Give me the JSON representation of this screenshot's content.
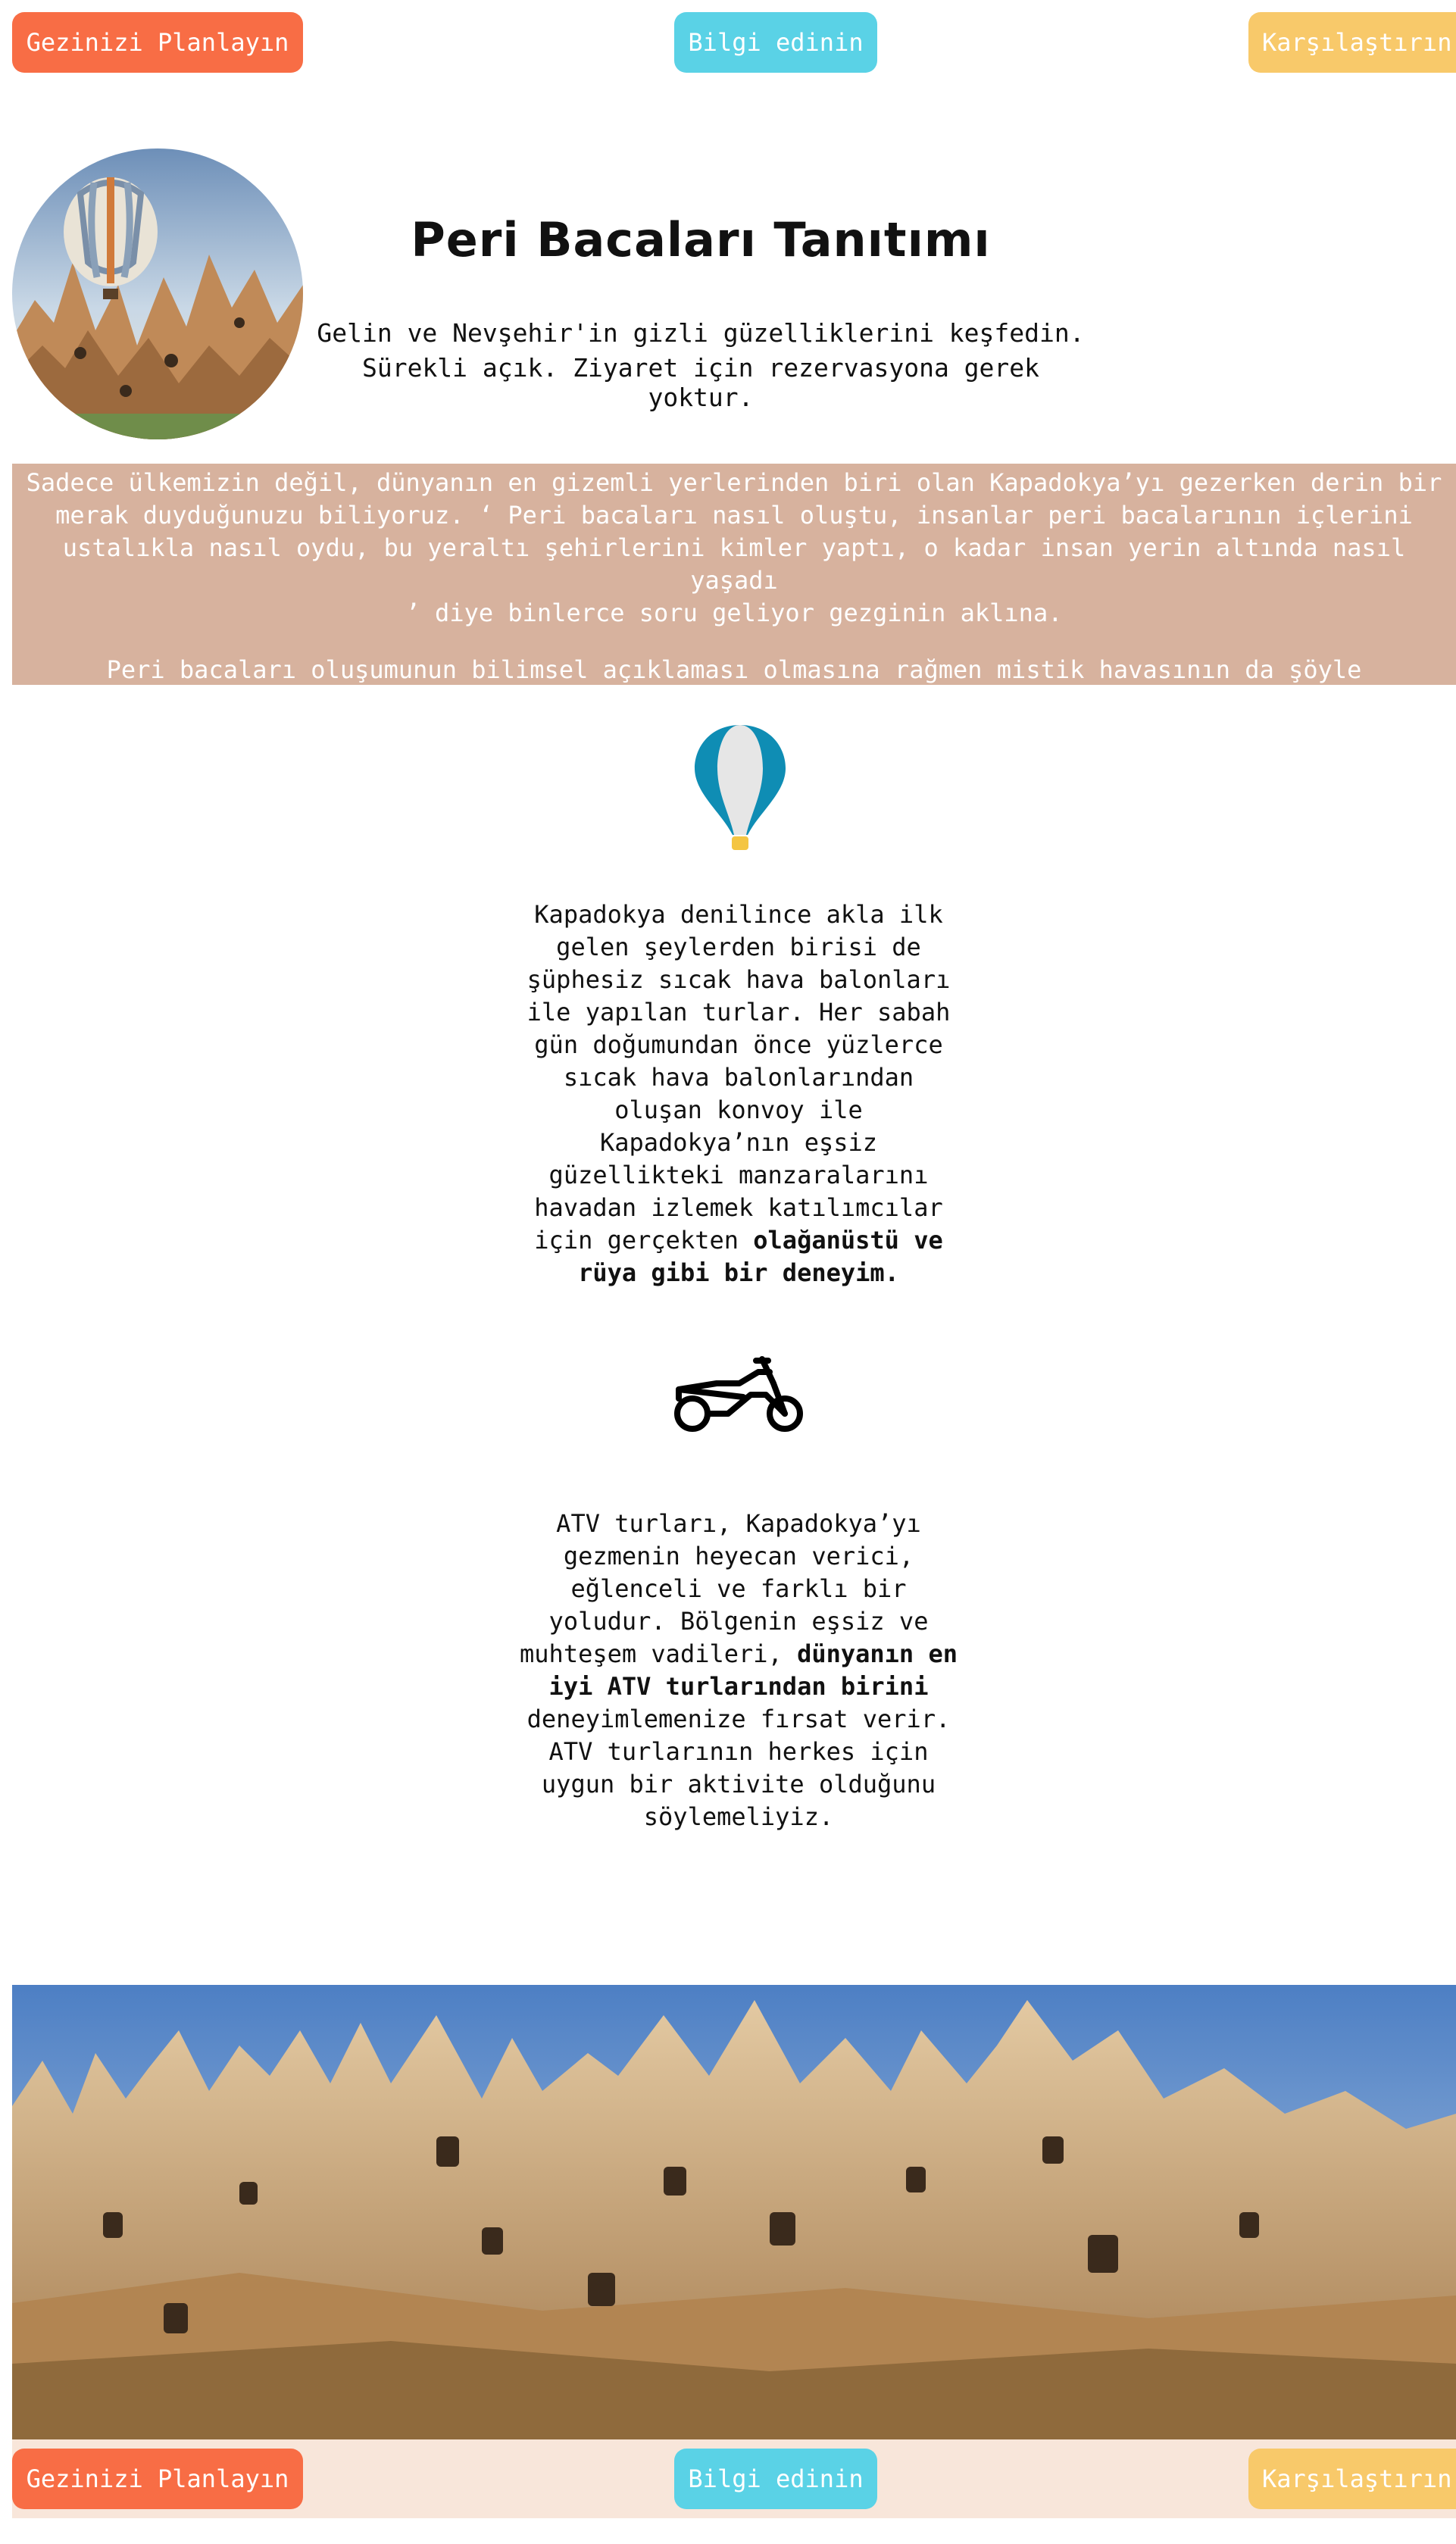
{
  "nav": {
    "plan_label": "Gezinizi Planlayın",
    "info_label": "Bilgi edinin",
    "compare_label": "Karşılaştırın"
  },
  "header": {
    "title": "Peri Bacaları Tanıtımı",
    "subtitle_line1": "Gelin ve Nevşehir'in gizli güzelliklerini keşfedin.",
    "subtitle_line2": "Sürekli açık. Ziyaret için rezervasyona gerek yoktur."
  },
  "intro": {
    "paragraph1": "Sadece ülkemizin değil, dünyanın en gizemli yerlerinden biri olan Kapadokya’yı gezerken derin bir\nmerak duyduğunuzu biliyoruz. ‘ Peri bacaları nasıl oluştu, insanlar peri bacalarının içlerini\nustalıkla nasıl oydu, bu yeraltı şehirlerini kimler yaptı, o kadar insan yerin altında nasıl yaşadı\n’ diye binlerce soru geliyor gezginin aklına.",
    "paragraph2": "Peri bacaları oluşumunun bilimsel açıklaması olmasına rağmen mistik havasının da şöyle düşündürdüğünü\nbiliyoruz; ‘Kapadokya eskiden perilerin cenneti miydi, yoksa doğa bir mucize mi göstermek istedi!’"
  },
  "balloon_section": {
    "text": "Kapadokya denilince akla ilk gelen şeylerden birisi de şüphesiz sıcak hava balonları ile yapılan turlar. Her sabah gün doğumundan önce yüzlerce sıcak hava balonlarından oluşan konvoy ile Kapadokya’nın eşsiz güzellikteki manzaralarını havadan izlemek katılımcılar için gerçekten ",
    "bold": "olağanüstü ve rüya gibi bir deneyim."
  },
  "atv_section": {
    "text_before": "ATV turları, Kapadokya’yı gezmenin heyecan verici, eğlenceli ve farklı bir yoludur. Bölgenin eşsiz ve muhteşem vadileri, ",
    "bold": "dünyanın en iyi ATV turlarından birini",
    "text_after": " deneyimlemenize fırsat verir. ATV turlarının herkes için uygun bir aktivite olduğunu söylemeliyiz."
  },
  "icons": {
    "balloon": "hot-air-balloon-icon",
    "motorcycle": "atv-motorcycle-icon"
  },
  "colors": {
    "plan": "#f86d45",
    "info": "#5ad2e6",
    "compare": "#f8c96a",
    "intro_bg": "#d7b29e",
    "footer_bg": "#f8e6da"
  }
}
